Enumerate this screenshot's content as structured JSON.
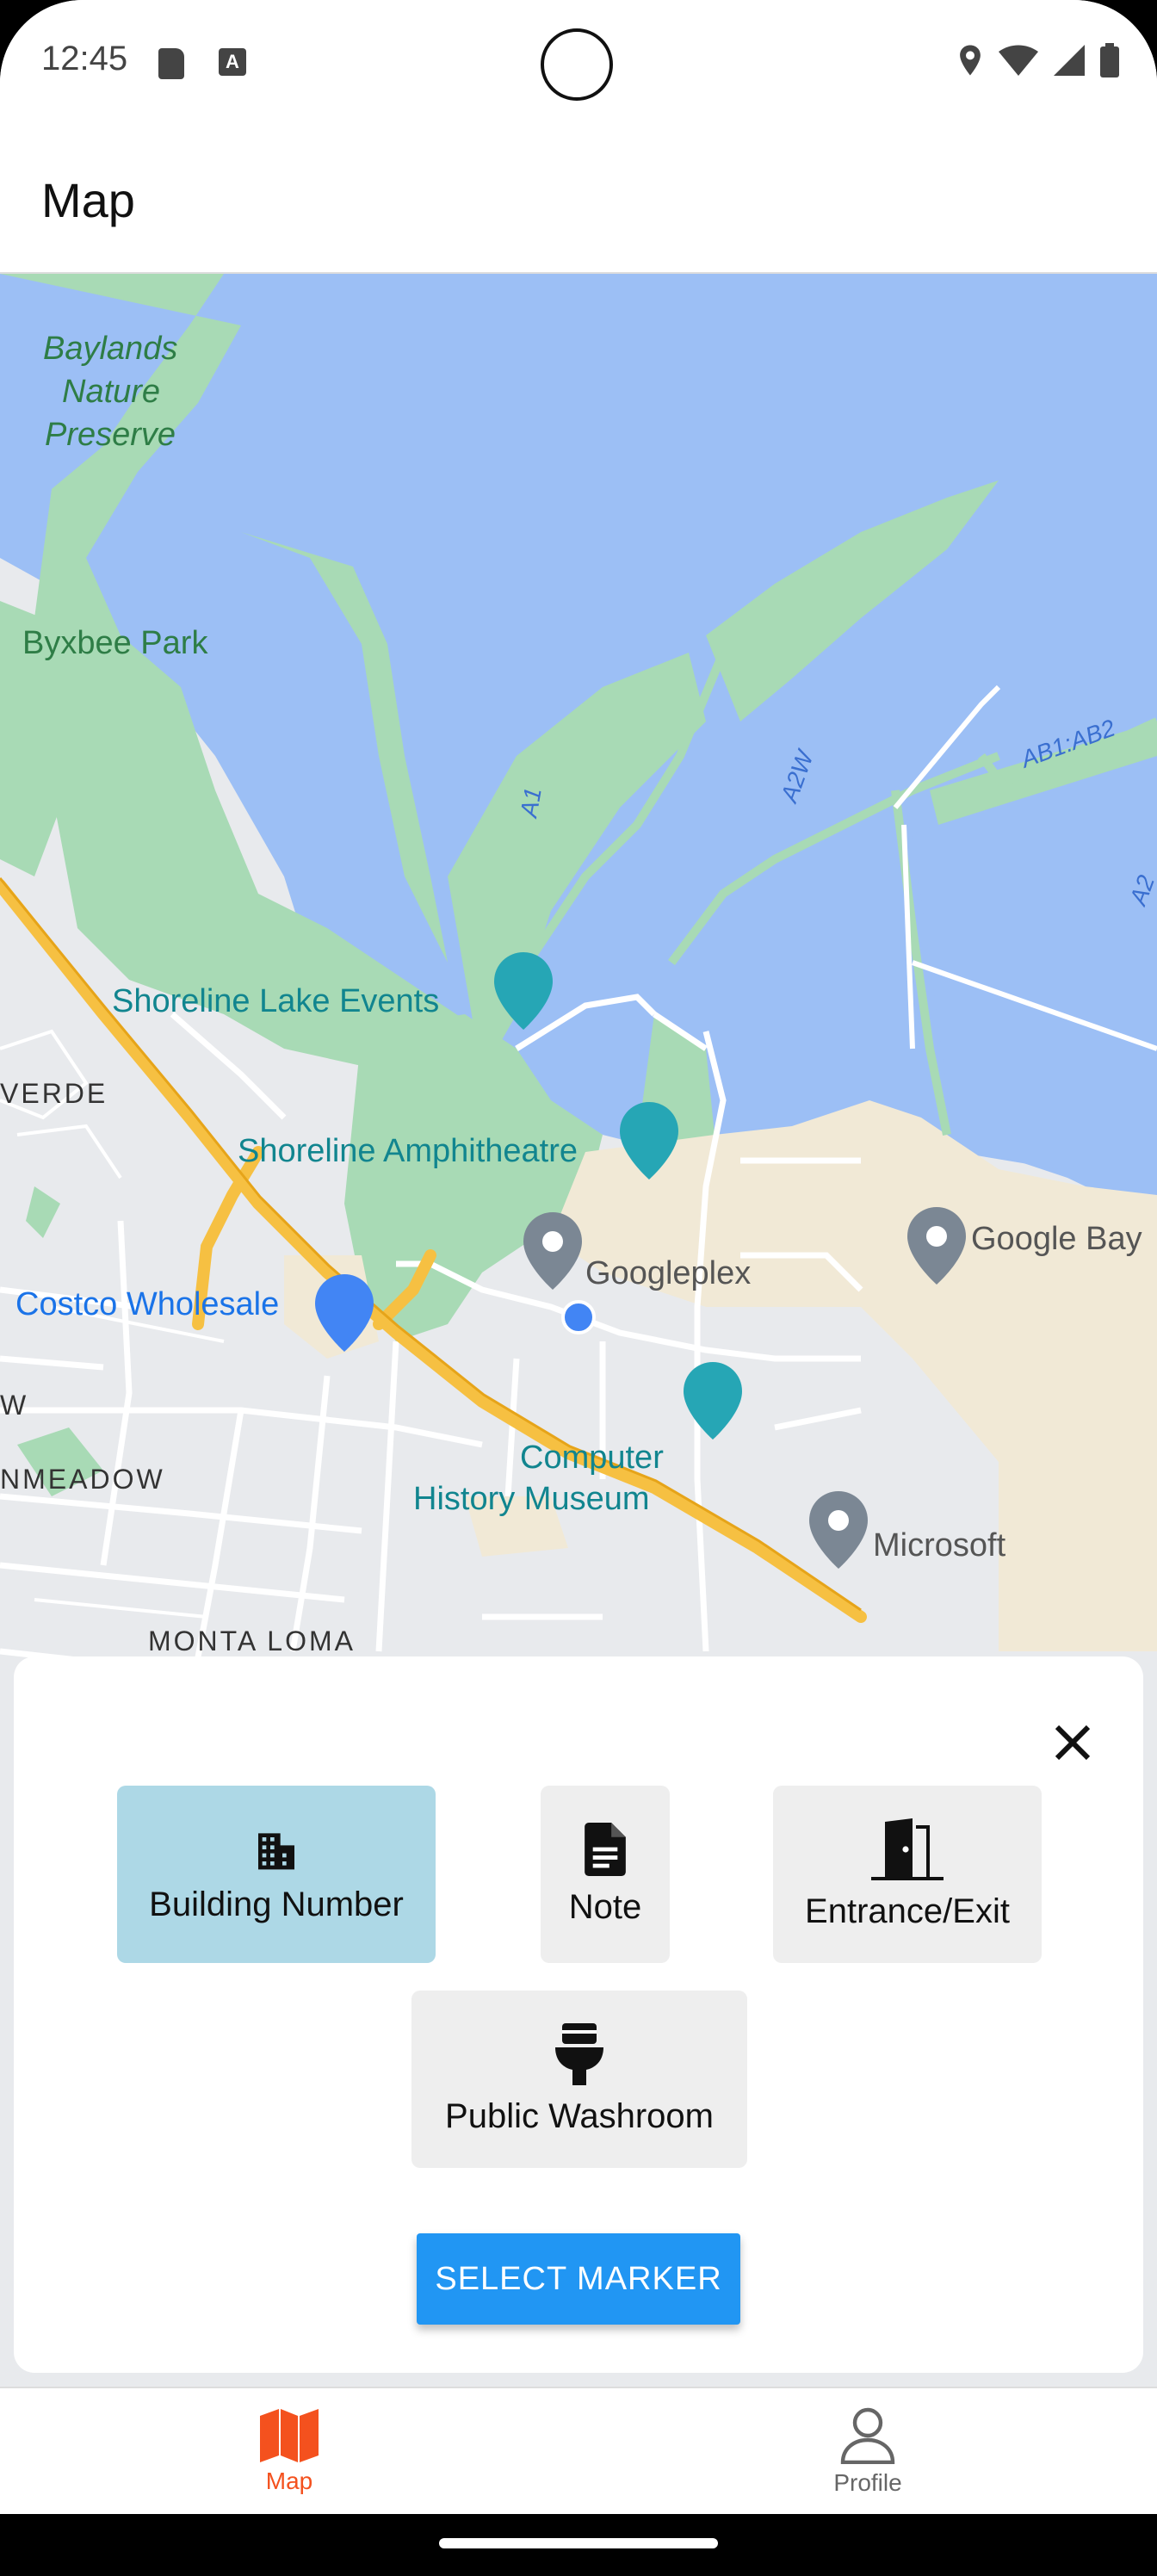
{
  "status_bar": {
    "time": "12:45",
    "icons": [
      "sd-card-icon",
      "a-notification-icon",
      "location-icon",
      "wifi-icon",
      "signal-icon",
      "battery-icon"
    ]
  },
  "app_bar": {
    "title": "Map"
  },
  "map": {
    "labels": {
      "baylands": "Baylands",
      "nature": "Nature",
      "preserve": "Preserve",
      "byxbee": "Byxbee Park",
      "shoreline_lake": "Shoreline Lake Events",
      "verde": "VERDE",
      "shoreline_amph": "Shoreline Amphitheatre",
      "costco": "Costco Wholesale",
      "googleplex": "Googleplex",
      "google_bay": "Google Bay",
      "w": "W",
      "nmeadow": "NMEADOW",
      "computer": "Computer",
      "history_museum": "History Museum",
      "microsoft": "Microsoft",
      "monta_loma": "MONTA LOMA",
      "a1": "A1",
      "a2w": "A2W",
      "ab1ab2": "AB1:AB2",
      "a2": "A2"
    },
    "colors": {
      "water": "#9cbff5",
      "park": "#a8dab5",
      "urban": "#e8eaed",
      "commercial": "#f1e9d6",
      "highway": "#f6c042",
      "road": "#ffffff"
    }
  },
  "marker_sheet": {
    "options": [
      {
        "label": "Building Number",
        "icon": "building-icon",
        "selected": true
      },
      {
        "label": "Note",
        "icon": "note-icon",
        "selected": false
      },
      {
        "label": "Entrance/Exit",
        "icon": "door-icon",
        "selected": false
      },
      {
        "label": "Public Washroom",
        "icon": "toilet-icon",
        "selected": false
      }
    ],
    "select_button": "SELECT MARKER",
    "colors": {
      "selected": "#add8e6",
      "unselected": "#eeeeee",
      "button": "#2196f3"
    }
  },
  "bottom_nav": {
    "items": [
      {
        "label": "Map",
        "icon": "map-icon",
        "active": true
      },
      {
        "label": "Profile",
        "icon": "person-icon",
        "active": false
      }
    ],
    "colors": {
      "active": "#f4511e",
      "inactive": "#666666"
    }
  }
}
